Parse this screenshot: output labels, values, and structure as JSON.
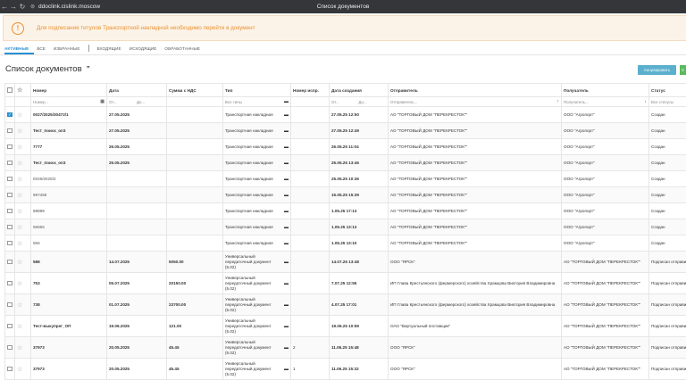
{
  "browser": {
    "url": "ddoclink.cislink.moscow",
    "title": "Список документов",
    "back_icon": "arrow-left-icon",
    "forward_icon": "arrow-right-icon",
    "reload_icon": "reload-icon"
  },
  "alert": {
    "message": "Для подписания титулов Транспортной накладной необходимо перейти в документ",
    "color": "#e8912d",
    "icon": "exclamation-circle-icon"
  },
  "tabs": [
    {
      "label": "Активные",
      "active": true
    },
    {
      "label": "Все"
    },
    {
      "label": "Избранные"
    },
    {
      "label": "Входящие"
    },
    {
      "label": "Исходящие"
    },
    {
      "label": "Обработанные"
    }
  ],
  "page": {
    "title": "Список документов",
    "annul_button": "Аннулировать",
    "green_button": "С"
  },
  "table": {
    "columns": [
      "Номер",
      "Дата",
      "Сумма с НДС",
      "Тип",
      "Номер испр.",
      "Дата создания",
      "Отправитель",
      "Получатель",
      "Статус"
    ],
    "filters": {
      "number_placeholder": "Номер...",
      "date_from": "От...",
      "date_to": "До...",
      "type_all": "Все типы",
      "created_from": "От...",
      "created_to": "До...",
      "sender_placeholder": "Отправитель...",
      "receiver_placeholder": "Получатель...",
      "status_all": "Все статусы"
    },
    "rows": [
      {
        "checked": true,
        "number": "0027/2025/30472/1",
        "date": "27.05.2025",
        "sum": "",
        "type": "Транспортная накладная",
        "fix": "",
        "created": "27.05.25 12:50",
        "sender": "АО \"ТОРГОВЫЙ ДОМ \"ПЕРЕКРЕСТОК\"\"",
        "receiver": "ООО \"Агропорт\"",
        "status": "Создан"
      },
      {
        "number": "Тест_поиск_оп3",
        "date": "27.05.2025",
        "sum": "",
        "type": "Транспортная накладная",
        "fix": "",
        "created": "27.05.25 12:49",
        "sender": "АО \"ТОРГОВЫЙ ДОМ \"ПЕРЕКРЕСТОК\"\"",
        "receiver": "ООО \"Агропорт\"",
        "status": "Создан"
      },
      {
        "number": "7777",
        "date": "26.05.2025",
        "sum": "",
        "type": "Транспортная накладная",
        "fix": "",
        "created": "26.05.25 11:04",
        "sender": "АО \"ТОРГОВЫЙ ДОМ \"ПЕРЕКРЕСТОК\"\"",
        "receiver": "ООО \"Агропорт\"",
        "status": "Создан"
      },
      {
        "number": "Тест_поиск_оп3",
        "date": "25.05.2025",
        "sum": "",
        "type": "Транспортная накладная",
        "fix": "",
        "created": "25.05.25 13:46",
        "sender": "АО \"ТОРГОВЫЙ ДОМ \"ПЕРЕКРЕСТОК\"\"",
        "receiver": "ООО \"Агропорт\"",
        "status": "Создан"
      },
      {
        "number": "0025/2025/2",
        "muted": true,
        "date": "",
        "sum": "",
        "type": "Транспортная накладная",
        "fix": "",
        "created": "25.05.25 10:36",
        "sender": "АО \"ТОРГОВЫЙ ДОМ \"ПЕРЕКРЕСТОК\"\"",
        "receiver": "ООО \"Агропорт\"",
        "status": "Создан"
      },
      {
        "number": "997456",
        "muted": true,
        "date": "",
        "sum": "",
        "type": "Транспортная накладная",
        "fix": "",
        "created": "15.05.25 15:39",
        "sender": "АО \"ТОРГОВЫЙ ДОМ \"ПЕРЕКРЕСТОК\"\"",
        "receiver": "ООО \"Агропорт\"",
        "status": "Создан"
      },
      {
        "number": "88888",
        "muted": true,
        "date": "",
        "sum": "",
        "type": "Транспортная накладная",
        "fix": "",
        "created": "1.05.25 17:13",
        "sender": "АО \"ТОРГОВЫЙ ДОМ \"ПЕРЕКРЕСТОК\"\"",
        "receiver": "ООО \"Агропорт\"",
        "status": "Создан"
      },
      {
        "number": "55555",
        "muted": true,
        "date": "",
        "sum": "",
        "type": "Транспортная накладная",
        "fix": "",
        "created": "1.05.25 13:13",
        "sender": "АО \"ТОРГОВЫЙ ДОМ \"ПЕРЕКРЕСТОК\"\"",
        "receiver": "ООО \"Агропорт\"",
        "status": "Создан"
      },
      {
        "number": "555",
        "muted": true,
        "date": "",
        "sum": "",
        "type": "Транспортная накладная",
        "fix": "",
        "created": "1.05.25 13:10",
        "sender": "АО \"ТОРГОВЫЙ ДОМ \"ПЕРЕКРЕСТОК\"\"",
        "receiver": "ООО \"Агропорт\"",
        "status": "Создан"
      },
      {
        "number": "588",
        "date": "14.07.2025",
        "sum": "5050.00",
        "type": "Универсальный передаточный документ (5.02)",
        "fix": "",
        "created": "14.07.25 13:48",
        "sender": "ООО \"ЯРСК\"",
        "receiver": "АО \"ТОРГОВЫЙ ДОМ \"ПЕРЕКРЕСТОК\"\"",
        "status": "Подписан отправител"
      },
      {
        "number": "753",
        "date": "05.07.2025",
        "sum": "20150.00",
        "type": "Универсальный передаточный документ (5.02)",
        "fix": "",
        "created": "7.07.25 12:55",
        "sender": "ИП Глава Крестьянского (фермерского) хозяйства Храмцова Виктория Владимировна",
        "receiver": "АО \"ТОРГОВЫЙ ДОМ \"ПЕРЕКРЕСТОК\"\"",
        "status": "Подписан отправител"
      },
      {
        "number": "738",
        "date": "01.07.2025",
        "sum": "23700.00",
        "type": "Универсальный передаточный документ (5.02)",
        "fix": "",
        "created": "4.07.25 17:01",
        "sender": "ИП Глава Крестьянского (фермерского) хозяйства Храмцова Виктория Владимировна",
        "receiver": "АО \"ТОРГОВЫЙ ДОМ \"ПЕРЕКРЕСТОК\"\"",
        "status": "Подписан отправител"
      },
      {
        "number": "Тест-выкупрег_ОП",
        "date": "19.06.2025",
        "sum": "121.00",
        "type": "Универсальный передаточный документ (5.02)",
        "fix": "",
        "created": "19.06.25 10:59",
        "sender": "ОАО \"Виртуальный поставщик\"",
        "receiver": "АО \"ТОРГОВЫЙ ДОМ \"ПЕРЕКРЕСТОК\"\"",
        "status": "Подписан отправител"
      },
      {
        "number": "37973",
        "date": "20.05.2025",
        "sum": "45.45",
        "type": "Универсальный передаточный документ (5.02)",
        "fix": "2",
        "created": "11.06.25 15:48",
        "sender": "ООО \"ЯРСК\"",
        "receiver": "АО \"ТОРГОВЫЙ ДОМ \"ПЕРЕКРЕСТОК\"\"",
        "status": "Подписан отправител"
      },
      {
        "number": "37973",
        "date": "20.05.2025",
        "sum": "45.45",
        "type": "Универсальный передаточный документ (5.02)",
        "fix": "1",
        "created": "11.06.25 15:32",
        "sender": "ООО \"ЯРСК\"",
        "receiver": "АО \"ТОРГОВЫЙ ДОМ \"ПЕРЕКРЕСТОК\"\"",
        "status": "Подписан отправител"
      }
    ]
  },
  "colors": {
    "accent": "#2a8fd1",
    "annul_button": "#5bb0cd",
    "green_button": "#5cb85c",
    "alert_bg": "#fcf3e8"
  }
}
